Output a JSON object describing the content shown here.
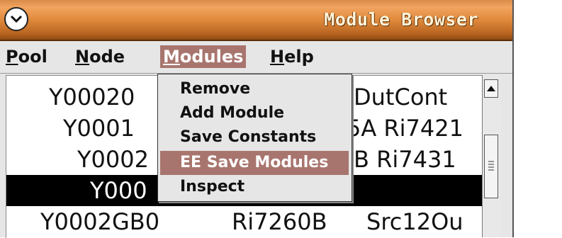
{
  "window": {
    "title": "Module Browser"
  },
  "menubar": [
    {
      "underline": "P",
      "rest": "ool"
    },
    {
      "underline": "N",
      "rest": "ode"
    },
    {
      "underline": "M",
      "rest": "odules"
    },
    {
      "underline": "H",
      "rest": "elp"
    }
  ],
  "modules_menu": [
    "Remove",
    "Add Module",
    "Save Constants",
    "EE Save Modules",
    "Inspect"
  ],
  "highlighted_menu_item": "EE Save Modules",
  "list_rows": [
    {
      "c1": "Y00020",
      "c2": "DutCont"
    },
    {
      "c1": "Y0001",
      "c2": "5A Ri7421"
    },
    {
      "c1": "Y0002",
      "c2": "B Ri7431"
    },
    {
      "c1": "Y000",
      "c2": ""
    },
    {
      "c1": "Y0002GB0",
      "c2": "Ri7260B",
      "c3": "Src12Ou"
    }
  ],
  "icons": {
    "window_menu": "chevron-down-circle-icon",
    "scroll_up": "arrow-up-icon",
    "scroll_thumb": "grip-icon"
  },
  "colors": {
    "title_bar": "#e08a3c",
    "menu_highlight": "#a8756e",
    "selection": "#000000"
  }
}
